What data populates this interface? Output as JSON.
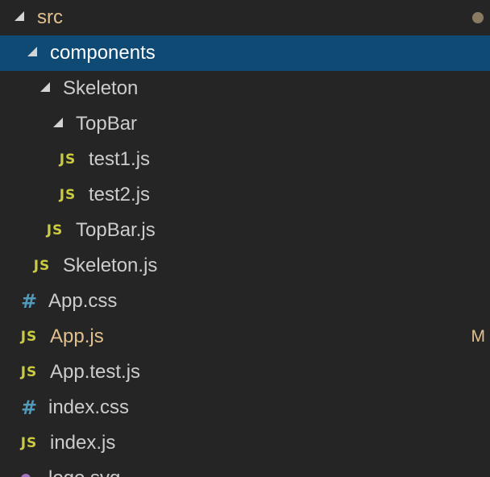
{
  "explorer": {
    "src": {
      "label": "src",
      "status": "modified-dot"
    },
    "components": {
      "label": "components"
    },
    "skeleton_folder": {
      "label": "Skeleton"
    },
    "topbar_folder": {
      "label": "TopBar"
    },
    "test1": {
      "label": "test1.js",
      "icon": "JS"
    },
    "test2": {
      "label": "test2.js",
      "icon": "JS"
    },
    "topbar_js": {
      "label": "TopBar.js",
      "icon": "JS"
    },
    "skeleton_js": {
      "label": "Skeleton.js",
      "icon": "JS"
    },
    "app_css": {
      "label": "App.css",
      "icon": "#"
    },
    "app_js": {
      "label": "App.js",
      "icon": "JS",
      "badge": "M"
    },
    "app_test_js": {
      "label": "App.test.js",
      "icon": "JS"
    },
    "index_css": {
      "label": "index.css",
      "icon": "#"
    },
    "index_js": {
      "label": "index.js",
      "icon": "JS"
    },
    "logo_svg": {
      "label": "logo.svg",
      "icon": "svg-icon"
    }
  },
  "colors": {
    "background": "#252526",
    "selected": "#0e4a74",
    "modified": "#e2c08d",
    "js_icon": "#cbcb41",
    "css_icon": "#519aba",
    "svg_icon": "#a074c4",
    "text": "#cccccc"
  }
}
